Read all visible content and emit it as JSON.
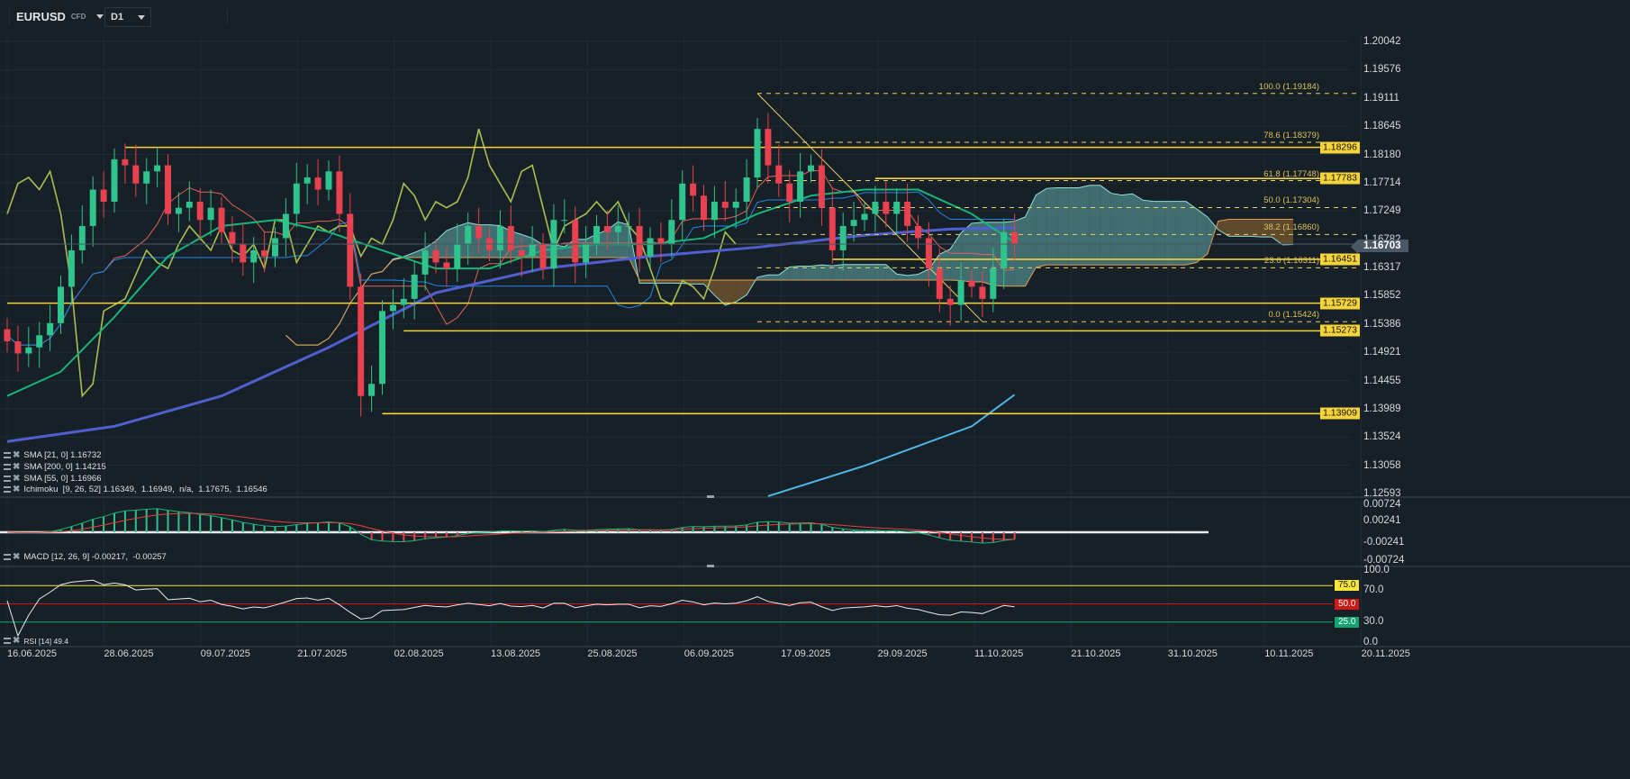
{
  "header": {
    "symbol": "EURUSD",
    "symbol_type": "CFD",
    "timeframe": "D1"
  },
  "colors": {
    "bull": "#2fc48d",
    "bear": "#e8414f",
    "level": "#f5d33a",
    "grid": "#212b35",
    "cloud_up": "#4f8a89",
    "cloud_down": "#7a5a30"
  },
  "price_axis": {
    "ticks": [
      "1.20042",
      "1.19576",
      "1.19111",
      "1.18645",
      "1.18180",
      "1.17714",
      "1.17249",
      "1.16782",
      "1.16317",
      "1.15852",
      "1.15386",
      "1.14921",
      "1.14455",
      "1.13989",
      "1.13524",
      "1.13058",
      "1.12593"
    ],
    "current_price": "1.16703"
  },
  "levels": [
    {
      "label": "1.18296",
      "price": 1.18296,
      "from_bar": 11
    },
    {
      "label": "1.17783",
      "price": 1.17783,
      "from_bar": 81
    },
    {
      "label": "1.16451",
      "price": 1.16451,
      "from_bar": 77
    },
    {
      "label": "1.15729",
      "price": 1.15729,
      "from_bar": 0
    },
    {
      "label": "1.15273",
      "price": 1.15273,
      "from_bar": 37
    },
    {
      "label": "1.13909",
      "price": 1.13909,
      "from_bar": 35
    }
  ],
  "fibonacci": {
    "from": {
      "bar": 70,
      "price": 1.19184
    },
    "to": {
      "bar": 91,
      "price": 1.15424
    },
    "levels": [
      {
        "label": "100.0 (1.19184)",
        "price": 1.19184
      },
      {
        "label": "78.6 (1.18379)",
        "price": 1.18379
      },
      {
        "label": "61.8 (1.17748)",
        "price": 1.17748
      },
      {
        "label": "50.0 (1.17304)",
        "price": 1.17304
      },
      {
        "label": "38.2 (1.16860)",
        "price": 1.1686
      },
      {
        "label": "23.6 (1.16311)",
        "price": 1.16311
      },
      {
        "label": "0.0 (1.15424)",
        "price": 1.15424
      }
    ]
  },
  "candles": {
    "first_open": 1.153,
    "closes": [
      1.151,
      1.149,
      1.15,
      1.152,
      1.154,
      1.16,
      1.166,
      1.17,
      1.176,
      1.174,
      1.181,
      1.18,
      1.177,
      1.179,
      1.18,
      1.172,
      1.173,
      1.174,
      1.171,
      1.173,
      1.169,
      1.167,
      1.164,
      1.166,
      1.165,
      1.168,
      1.172,
      1.177,
      1.178,
      1.176,
      1.179,
      1.172,
      1.16,
      1.142,
      1.144,
      1.156,
      1.157,
      1.158,
      1.162,
      1.166,
      1.164,
      1.163,
      1.167,
      1.17,
      1.168,
      1.166,
      1.17,
      1.166,
      1.165,
      1.167,
      1.163,
      1.171,
      1.171,
      1.164,
      1.167,
      1.17,
      1.169,
      1.17,
      1.17,
      1.165,
      1.168,
      1.167,
      1.171,
      1.177,
      1.175,
      1.171,
      1.174,
      1.173,
      1.174,
      1.178,
      1.186,
      1.18,
      1.177,
      1.174,
      1.179,
      1.18,
      1.173,
      1.166,
      1.17,
      1.171,
      1.172,
      1.174,
      1.172,
      1.174,
      1.17,
      1.168,
      1.163,
      1.158,
      1.157,
      1.161,
      1.16,
      1.158,
      1.163,
      1.169,
      1.167
    ]
  },
  "sma21": [
    [
      0,
      1.142
    ],
    [
      5,
      1.146
    ],
    [
      10,
      1.155
    ],
    [
      15,
      1.165
    ],
    [
      20,
      1.17
    ],
    [
      25,
      1.171
    ],
    [
      30,
      1.169
    ],
    [
      35,
      1.166
    ],
    [
      40,
      1.163
    ],
    [
      45,
      1.163
    ],
    [
      50,
      1.166
    ],
    [
      55,
      1.167
    ],
    [
      60,
      1.167
    ],
    [
      65,
      1.168
    ],
    [
      70,
      1.172
    ],
    [
      75,
      1.175
    ],
    [
      80,
      1.176
    ],
    [
      85,
      1.176
    ],
    [
      90,
      1.172
    ],
    [
      94,
      1.1673
    ]
  ],
  "sma55": [
    [
      0,
      1.1345
    ],
    [
      10,
      1.137
    ],
    [
      20,
      1.142
    ],
    [
      30,
      1.15
    ],
    [
      40,
      1.159
    ],
    [
      50,
      1.163
    ],
    [
      60,
      1.165
    ],
    [
      70,
      1.1665
    ],
    [
      80,
      1.1685
    ],
    [
      88,
      1.1695
    ],
    [
      94,
      1.1697
    ]
  ],
  "sma200": [
    [
      71,
      1.1255
    ],
    [
      80,
      1.1305
    ],
    [
      90,
      1.137
    ],
    [
      94,
      1.1422
    ]
  ],
  "legends": {
    "sma21": "SMA [21, 0] 1.16732",
    "sma200": "SMA [200, 0] 1.14215",
    "sma55": "SMA [55, 0] 1.16966",
    "ichimoku": "Ichimoku  [9, 26, 52] 1.16349,  1.16949,  n/a,  1.17675,  1.16546",
    "macd": "MACD [12, 26, 9] -0.00217,  -0.00257",
    "rsi": "RSI [14] 49.4"
  },
  "macd_axis": [
    "0.00724",
    "0.00241",
    "-0.00241",
    "-0.00724"
  ],
  "rsi_axis": {
    "ticks": [
      "100.0",
      "70.0",
      "30.0",
      "0.0"
    ],
    "levels": [
      {
        "label": "75.0",
        "value": 75,
        "color": "#f5e53a"
      },
      {
        "label": "50.0",
        "value": 50,
        "color": "#d01818"
      },
      {
        "label": "25.0",
        "value": 25,
        "color": "#12a374"
      }
    ]
  },
  "date_axis": [
    "16.06.2025",
    "28.06.2025",
    "09.07.2025",
    "21.07.2025",
    "02.08.2025",
    "13.08.2025",
    "25.08.2025",
    "06.09.2025",
    "17.09.2025",
    "29.09.2025",
    "11.10.2025",
    "21.10.2025",
    "31.10.2025",
    "10.11.2025",
    "20.11.2025"
  ]
}
